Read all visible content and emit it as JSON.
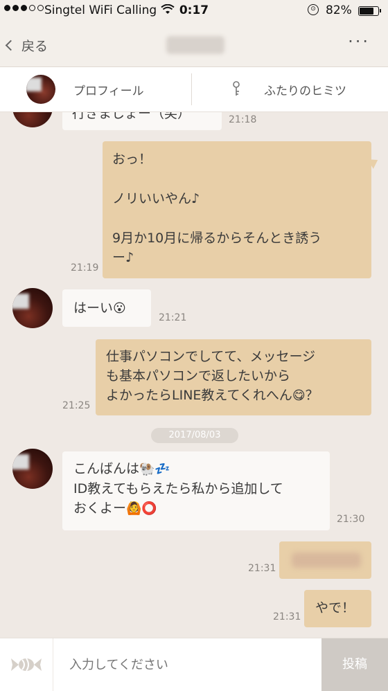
{
  "status_bar": {
    "carrier": "Singtel WiFi Calling",
    "time": "0:17",
    "battery": "82%",
    "battery_level": 0.82,
    "signal_bars_filled": 3,
    "signal_bars_total": 5
  },
  "nav": {
    "back_label": "戻る",
    "more_label": "···"
  },
  "tabs": {
    "profile_label": "プロフィール",
    "secret_label": "ふたりのヒミツ"
  },
  "messages": {
    "m0": {
      "text": "行きましょー（笑）",
      "time": "21:18"
    },
    "m1": {
      "line1": "おっ！",
      "line2": "ノリいいやん♪",
      "line3": "9月か10月に帰るからそんとき誘う",
      "line4": "ー♪",
      "time": "21:19"
    },
    "m2": {
      "text": "はーい",
      "emoji": "😮",
      "time": "21:21"
    },
    "m3": {
      "line1": "仕事パソコンでしてて、メッセージ",
      "line2": "も基本パソコンで返したいから",
      "line3": "よかったらLINE教えてくれへん",
      "line3_emoji": "😋",
      "line3_end": "？",
      "time": "21:25"
    },
    "date": "2017/08/03",
    "m4": {
      "line1": "こんばんは",
      "line1_emoji": "🐏💤",
      "line2": "ID教えてもらえたら私から追加して",
      "line3": "おくよー",
      "line3_emoji": "🙆⭕",
      "time": "21:30"
    },
    "m5": {
      "time": "21:31"
    },
    "m6": {
      "text": "やで！",
      "time": "21:31"
    }
  },
  "composer": {
    "placeholder": "入力してください",
    "post_label": "投稿"
  },
  "colors": {
    "background": "#efe9e4",
    "outgoing_bubble": "#e8cfa8",
    "incoming_bubble": "#faf8f6"
  }
}
